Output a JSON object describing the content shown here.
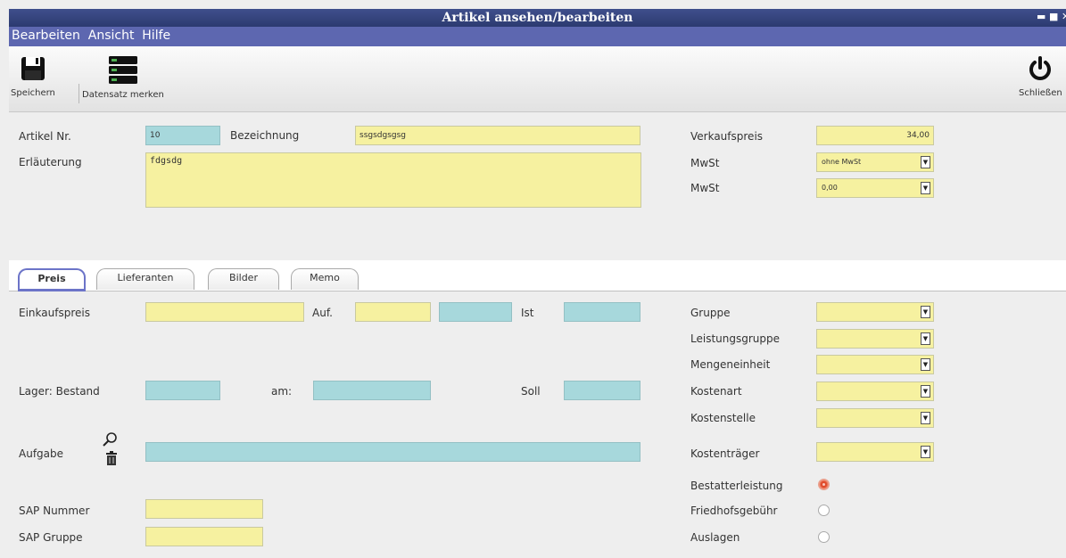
{
  "window": {
    "title": "Artikel ansehen/bearbeiten"
  },
  "menu": {
    "items": [
      "Bearbeiten",
      "Ansicht",
      "Hilfe"
    ]
  },
  "toolbar": {
    "save_label": "Speichern",
    "bookmark_label": "Datensatz merken",
    "close_label": "Schließen"
  },
  "header": {
    "artikel_nr_label": "Artikel Nr.",
    "artikel_nr_value": "10",
    "bezeichnung_label": "Bezeichnung",
    "bezeichnung_value": "ssgsdgsgsg",
    "erlaeuterung_label": "Erläuterung",
    "erlaeuterung_value": "fdgsdg",
    "verkaufspreis_label": "Verkaufspreis",
    "verkaufspreis_value": "34,00",
    "mwst_label": "MwSt",
    "mwst_value": "ohne MwSt",
    "mwst2_label": "MwSt",
    "mwst2_value": "0,00"
  },
  "tabs": [
    {
      "label": "Preis",
      "active": true
    },
    {
      "label": "Lieferanten",
      "active": false
    },
    {
      "label": "Bilder",
      "active": false
    },
    {
      "label": "Memo",
      "active": false
    }
  ],
  "preis": {
    "einkaufspreis_label": "Einkaufspreis",
    "auf_label": "Auf.",
    "ist_label": "Ist",
    "lager_label": "Lager: Bestand",
    "am_label": "am:",
    "soll_label": "Soll",
    "aufgabe_label": "Aufgabe",
    "sap_nummer_label": "SAP Nummer",
    "sap_gruppe_label": "SAP Gruppe",
    "gruppe_label": "Gruppe",
    "leistungsgruppe_label": "Leistungsgruppe",
    "mengeneinheit_label": "Mengeneinheit",
    "kostenart_label": "Kostenart",
    "kostenstelle_label": "Kostenstelle",
    "kostentraeger_label": "Kostenträger",
    "bestatterleistung_label": "Bestatterleistung",
    "bestatterleistung_checked": true,
    "friedhofsgebuehr_label": "Friedhofsgebühr",
    "friedhofsgebuehr_checked": false,
    "auslagen_label": "Auslagen",
    "auslagen_checked": false
  },
  "colors": {
    "title_bar": "#2c3a70",
    "menu_bar": "#5d67b0",
    "field_yellow": "#f6f1a0",
    "field_blue": "#a7d8dc",
    "radio_on": "#e04b2b"
  }
}
